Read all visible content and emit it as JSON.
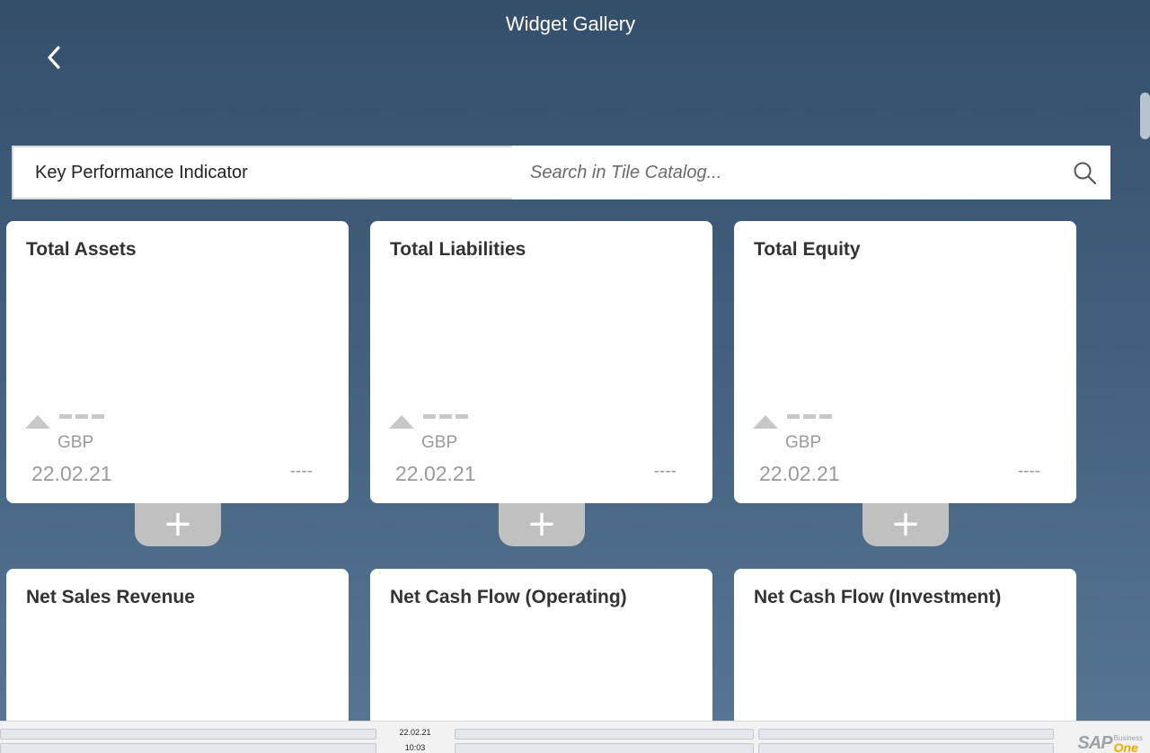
{
  "header": {
    "title": "Widget Gallery",
    "back_icon": "chevron-left-icon"
  },
  "filter": {
    "category": "Key Performance Indicator",
    "search_placeholder": "Search in Tile Catalog...",
    "search_value": "",
    "search_icon": "search-icon"
  },
  "tiles": [
    {
      "title": "Total Assets",
      "trend_icon": "triangle-up-icon",
      "unit": "GBP",
      "date": "22.02.21",
      "change": "----",
      "add_label": "+"
    },
    {
      "title": "Total Liabilities",
      "trend_icon": "triangle-up-icon",
      "unit": "GBP",
      "date": "22.02.21",
      "change": "----",
      "add_label": "+"
    },
    {
      "title": "Total Equity",
      "trend_icon": "triangle-up-icon",
      "unit": "GBP",
      "date": "22.02.21",
      "change": "----",
      "add_label": "+"
    },
    {
      "title": "Net Sales Revenue"
    },
    {
      "title": "Net Cash Flow (Operating)"
    },
    {
      "title": "Net Cash Flow (Investment)"
    }
  ],
  "status_bar": {
    "date": "22.02.21",
    "time": "10:03",
    "logo_text": "SAP",
    "logo_business": "Business",
    "logo_one": "One"
  },
  "colors": {
    "background_top": "#354f6b",
    "background_bottom": "#587794",
    "tile": "#ffffff",
    "add_button": "#c0c0c0",
    "logo_accent": "#f0ab00"
  }
}
